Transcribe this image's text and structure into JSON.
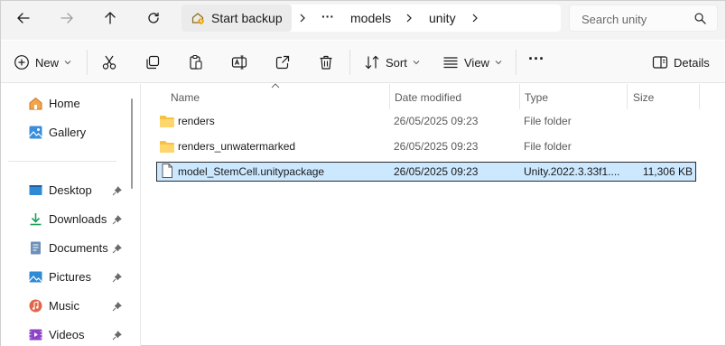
{
  "nav": {
    "back_icon": "arrow-left-icon",
    "forward_icon": "arrow-right-icon",
    "up_icon": "arrow-up-icon",
    "refresh_icon": "refresh-icon"
  },
  "address": {
    "home_label": "Start backup",
    "ellipsis": "···",
    "crumbs": [
      "models",
      "unity"
    ]
  },
  "search": {
    "placeholder": "Search unity"
  },
  "commands": {
    "new_label": "New",
    "sort_label": "Sort",
    "view_label": "View",
    "more_label": "···",
    "details_label": "Details"
  },
  "sidebar": {
    "top_items": [
      {
        "label": "Home",
        "icon": "home-icon"
      },
      {
        "label": "Gallery",
        "icon": "gallery-icon"
      }
    ],
    "pinned_items": [
      {
        "label": "Desktop",
        "icon": "desktop-icon"
      },
      {
        "label": "Downloads",
        "icon": "downloads-icon"
      },
      {
        "label": "Documents",
        "icon": "documents-icon"
      },
      {
        "label": "Pictures",
        "icon": "pictures-icon"
      },
      {
        "label": "Music",
        "icon": "music-icon"
      },
      {
        "label": "Videos",
        "icon": "videos-icon"
      }
    ]
  },
  "columns": {
    "name": "Name",
    "date": "Date modified",
    "type": "Type",
    "size": "Size"
  },
  "files": [
    {
      "name": "renders",
      "date": "26/05/2025 09:23",
      "type": "File folder",
      "size": "",
      "kind": "folder"
    },
    {
      "name": "renders_unwatermarked",
      "date": "26/05/2025 09:23",
      "type": "File folder",
      "size": "",
      "kind": "folder"
    },
    {
      "name": "model_StemCell.unitypackage",
      "date": "26/05/2025 09:23",
      "type": "Unity.2022.3.33f1....",
      "size": "11,306 KB",
      "kind": "file",
      "selected": true
    }
  ],
  "colors": {
    "accent": "#0067c0",
    "folder": "#f5c242",
    "selection_bg": "#cce8ff"
  }
}
